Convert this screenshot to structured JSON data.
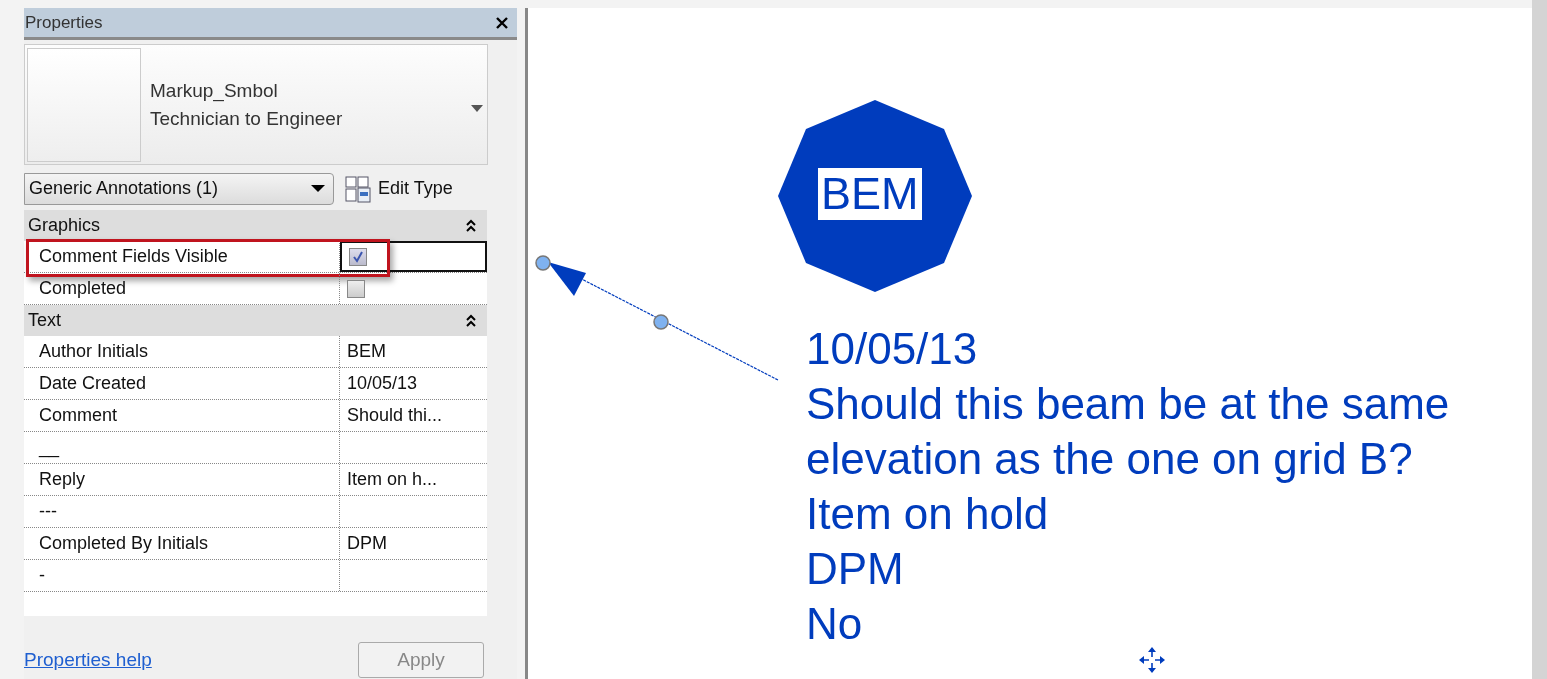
{
  "panel": {
    "title": "Properties",
    "type_selector": {
      "family": "Markup_Smbol",
      "type": "Technician to Engineer"
    },
    "filter": {
      "value": "Generic Annotations (1)"
    },
    "edit_type": "Edit Type",
    "groups": [
      {
        "label": "Graphics",
        "expanded": true,
        "rows": [
          {
            "kind": "checkbox",
            "label": "Comment Fields Visible",
            "checked": true,
            "selected": true,
            "highlighted": true
          },
          {
            "kind": "checkbox",
            "label": "Completed",
            "checked": false,
            "selected": false,
            "highlighted": false
          }
        ]
      },
      {
        "label": "Text",
        "expanded": true,
        "rows": [
          {
            "kind": "text",
            "label": "Author Initials",
            "value": "BEM",
            "selected": false,
            "highlighted": false
          },
          {
            "kind": "text",
            "label": "Date Created",
            "value": "10/05/13",
            "selected": false,
            "highlighted": false
          },
          {
            "kind": "text",
            "label": "Comment",
            "value": "Should thi...",
            "selected": false,
            "highlighted": false
          },
          {
            "kind": "text",
            "label": "__",
            "selected": false,
            "highlighted": false
          },
          {
            "kind": "text",
            "label": "Reply",
            "value": "Item on h...",
            "selected": false,
            "highlighted": false
          },
          {
            "kind": "text",
            "label": "---",
            "selected": false,
            "highlighted": false
          },
          {
            "kind": "text",
            "label": "Completed By Initials",
            "value": "DPM",
            "selected": false,
            "highlighted": false
          },
          {
            "kind": "text",
            "label": "-",
            "selected": false,
            "highlighted": false
          }
        ]
      }
    ],
    "help_link": "Properties help",
    "apply": {
      "label": "Apply",
      "disabled": true
    }
  },
  "canvas": {
    "tag": "BEM",
    "note_lines": [
      "10/05/13",
      "Should this beam be at the same",
      "elevation as the one on grid B?",
      "Item on hold",
      "DPM",
      "No"
    ]
  }
}
